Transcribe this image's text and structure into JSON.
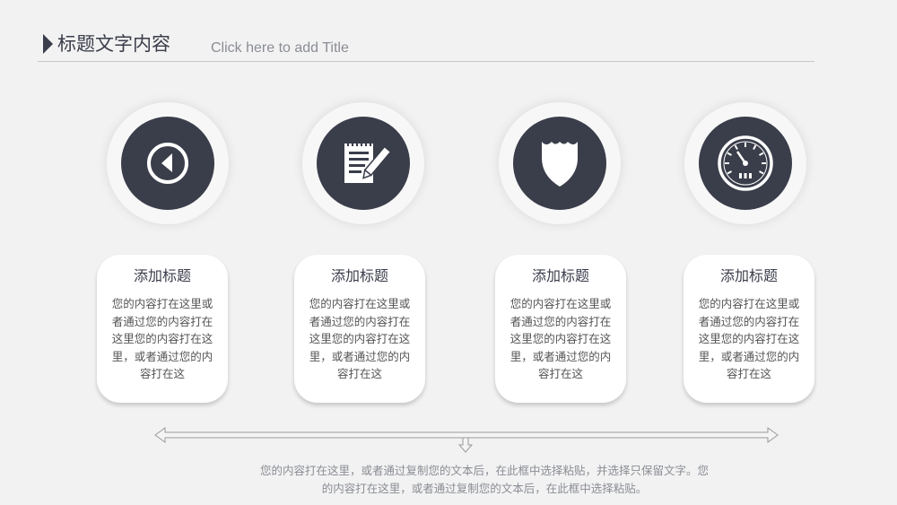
{
  "header": {
    "title": "标题文字内容",
    "subtitle": "Click here to add Title"
  },
  "colors": {
    "accent": "#3a3d4a",
    "background": "#f2f2f2",
    "card": "#ffffff"
  },
  "items": [
    {
      "icon": "compass-icon",
      "title": "添加标题",
      "body": "您的内容打在这里或者通过您的内容打在这里您的内容打在这里，或者通过您的内容打在这"
    },
    {
      "icon": "notepad-pen-icon",
      "title": "添加标题",
      "body": "您的内容打在这里或者通过您的内容打在这里您的内容打在这里，或者通过您的内容打在这"
    },
    {
      "icon": "shield-icon",
      "title": "添加标题",
      "body": "您的内容打在这里或者通过您的内容打在这里您的内容打在这里，或者通过您的内容打在这"
    },
    {
      "icon": "speedometer-icon",
      "title": "添加标题",
      "body": "您的内容打在这里或者通过您的内容打在这里您的内容打在这里，或者通过您的内容打在这"
    }
  ],
  "footer": {
    "text": "您的内容打在这里，或者通过复制您的文本后，在此框中选择粘贴，并选择只保留文字。您的内容打在这里，或者通过复制您的文本后，在此框中选择粘贴。"
  }
}
